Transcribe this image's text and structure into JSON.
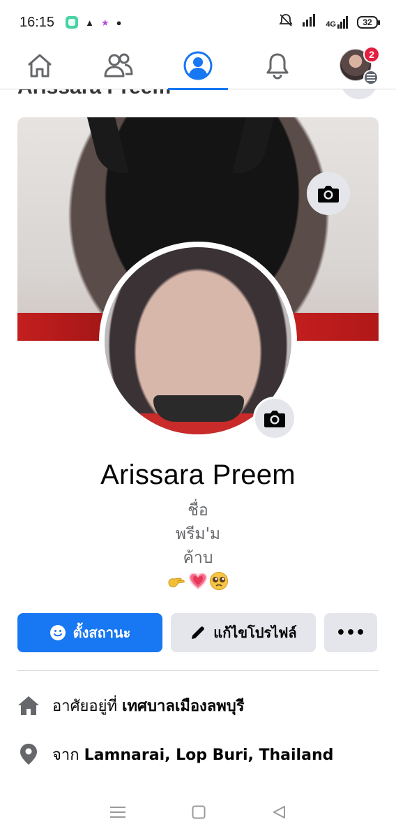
{
  "status_bar": {
    "time": "16:15",
    "network": "4G",
    "battery": "32"
  },
  "nav": {
    "items": [
      {
        "name": "home",
        "icon": "home-icon"
      },
      {
        "name": "friends",
        "icon": "friends-icon"
      },
      {
        "name": "profile",
        "icon": "profile-icon",
        "active": true
      },
      {
        "name": "notifications",
        "icon": "bell-icon"
      },
      {
        "name": "menu",
        "icon": "avatar-menu-icon"
      }
    ],
    "menu_badge": "2"
  },
  "scrolled_header": {
    "name": "Arissara Preem"
  },
  "profile": {
    "name": "Arissara Preem",
    "bio_lines": [
      "ชื่อ",
      "พรีม'ม",
      "ค้าบ"
    ]
  },
  "actions": {
    "status_label": "ตั้งสถานะ",
    "edit_label": "แก้ไขโปรไฟล์",
    "more_label": "•••"
  },
  "details": {
    "lives_prefix": "อาศัยอยู่ที่",
    "lives_value": "เทศบาลเมืองลพบุรี",
    "from_prefix": "จาก",
    "from_value": "Lamnarai, Lop Buri, Thailand"
  },
  "colors": {
    "accent": "#1877f2",
    "badge": "#e41e3f",
    "secondary_button": "#e4e6eb"
  }
}
